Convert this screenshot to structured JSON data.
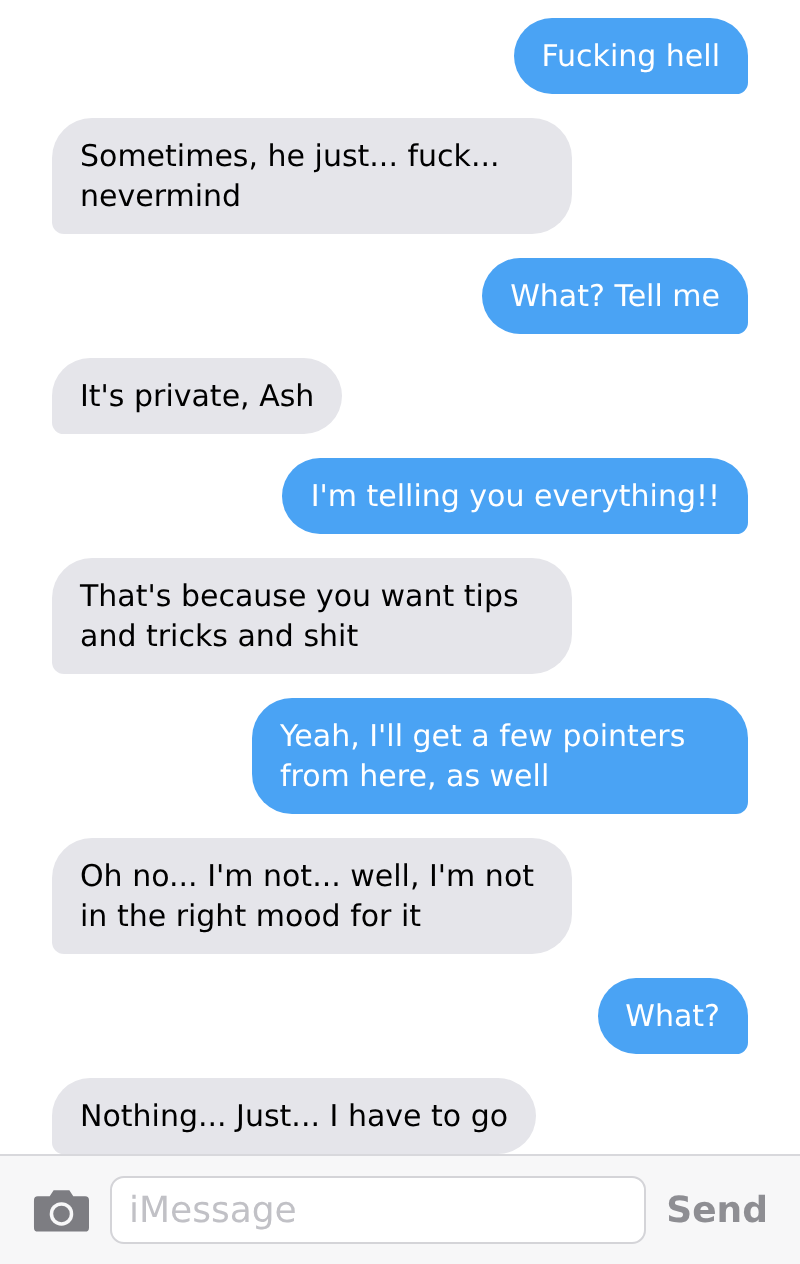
{
  "messages": [
    {
      "kind": "sent",
      "text": "Fucking hell"
    },
    {
      "kind": "received",
      "text": "Sometimes, he just... fuck... nevermind"
    },
    {
      "kind": "sent",
      "text": "What? Tell me"
    },
    {
      "kind": "received",
      "text": "It's private, Ash"
    },
    {
      "kind": "sent",
      "text": "I'm telling you everything!!"
    },
    {
      "kind": "received",
      "text": "That's because you want tips and tricks and shit"
    },
    {
      "kind": "sent",
      "text": "Yeah, I'll get a few pointers from here, as well"
    },
    {
      "kind": "received",
      "text": "Oh no... I'm not... well, I'm not in the right mood for it"
    },
    {
      "kind": "sent",
      "text": "What?"
    },
    {
      "kind": "received",
      "text": "Nothing... Just... I have to go"
    }
  ],
  "composer": {
    "placeholder": "iMessage",
    "send": "Send"
  }
}
